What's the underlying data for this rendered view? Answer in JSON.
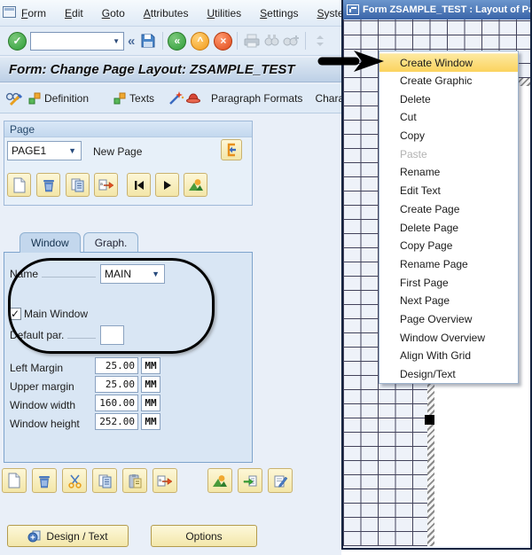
{
  "colors": {
    "sap_blue": "#3f6eb5",
    "menu_highlight": "#fbd35e",
    "button_yellow": "#faf2c6",
    "grid_line": "#42425a"
  },
  "glyphs": {
    "caret_down": "▼",
    "chevrons_left": "«",
    "check": "✓",
    "cross": "×",
    "caret_up": "^"
  },
  "menu_bar": {
    "items": [
      "Form",
      "Edit",
      "Goto",
      "Attributes",
      "Utilities",
      "Settings",
      "System"
    ]
  },
  "toolbar": {
    "command_value": ""
  },
  "screen_title": "Form: Change Page Layout: ZSAMPLE_TEST",
  "app_toolbar": {
    "definition": "Definition",
    "texts": "Texts",
    "paragraph_formats": "Paragraph Formats",
    "character_formats": "Characte"
  },
  "page_group": {
    "title": "Page",
    "selected_page": "PAGE1",
    "description": "New Page"
  },
  "tabs": [
    {
      "label": "Window",
      "active": true
    },
    {
      "label": "Graph.",
      "active": false
    }
  ],
  "window_tab": {
    "name_label": "Name",
    "name_value": "MAIN",
    "main_window_label": "Main Window",
    "main_window_checked": true,
    "default_par_label": "Default par.",
    "default_par_value": "",
    "fields": [
      {
        "label": "Left Margin",
        "value": "25.00",
        "unit": "MM"
      },
      {
        "label": "Upper margin",
        "value": "25.00",
        "unit": "MM"
      },
      {
        "label": "Window width",
        "value": "160.00",
        "unit": "MM"
      },
      {
        "label": "Window height",
        "value": "252.00",
        "unit": "MM"
      }
    ]
  },
  "action_buttons": {
    "design_text": "Design / Text",
    "options": "Options"
  },
  "painter_window": {
    "title": "Form ZSAMPLE_TEST : Layout of Pag"
  },
  "context_menu": {
    "items": [
      {
        "label": "Create Window",
        "state": "highlighted"
      },
      {
        "label": "Create Graphic",
        "state": "normal"
      },
      {
        "label": "Delete",
        "state": "normal"
      },
      {
        "label": "Cut",
        "state": "normal"
      },
      {
        "label": "Copy",
        "state": "normal"
      },
      {
        "label": "Paste",
        "state": "disabled"
      },
      {
        "label": "Rename",
        "state": "normal"
      },
      {
        "label": "Edit Text",
        "state": "normal"
      },
      {
        "label": "Create Page",
        "state": "normal"
      },
      {
        "label": "Delete Page",
        "state": "normal"
      },
      {
        "label": "Copy Page",
        "state": "normal"
      },
      {
        "label": "Rename Page",
        "state": "normal"
      },
      {
        "label": "First Page",
        "state": "normal"
      },
      {
        "label": "Next Page",
        "state": "normal"
      },
      {
        "label": "Page Overview",
        "state": "normal"
      },
      {
        "label": "Window Overview",
        "state": "normal"
      },
      {
        "label": "Align With Grid",
        "state": "normal"
      },
      {
        "label": "Design/Text",
        "state": "normal"
      }
    ]
  }
}
